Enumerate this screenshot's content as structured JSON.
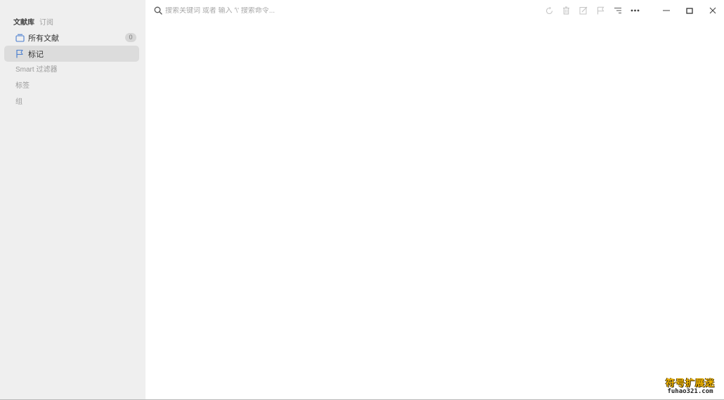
{
  "sidebar": {
    "tabs": [
      {
        "label": "文献库",
        "active": true
      },
      {
        "label": "订阅",
        "active": false
      }
    ],
    "items": [
      {
        "label": "所有文献",
        "icon": "library-box-icon",
        "badge": "0",
        "selected": false
      },
      {
        "label": "标记",
        "icon": "flag-icon",
        "selected": true
      }
    ],
    "sections": [
      {
        "label": "Smart 过滤器"
      },
      {
        "label": "标签"
      },
      {
        "label": "组"
      }
    ]
  },
  "search": {
    "placeholder": "搜索关键词 或者 输入 '\\' 搜索命令...",
    "value": ""
  },
  "toolbar": {
    "buttons": [
      {
        "name": "refresh-icon"
      },
      {
        "name": "trash-icon"
      },
      {
        "name": "edit-icon"
      },
      {
        "name": "flag-icon"
      },
      {
        "name": "sort-icon"
      },
      {
        "name": "more-icon"
      }
    ]
  },
  "window": {
    "minimize": "minimize-icon",
    "maximize": "maximize-icon",
    "close": "close-icon"
  },
  "watermark": {
    "title": "符号扩展迷",
    "subtitle": "fuhao321.com"
  },
  "colors": {
    "sidebar_bg": "#efefef",
    "selected_bg": "#dcdcdc",
    "accent_icon": "#4a7ecf",
    "watermark": "#f0b400"
  }
}
